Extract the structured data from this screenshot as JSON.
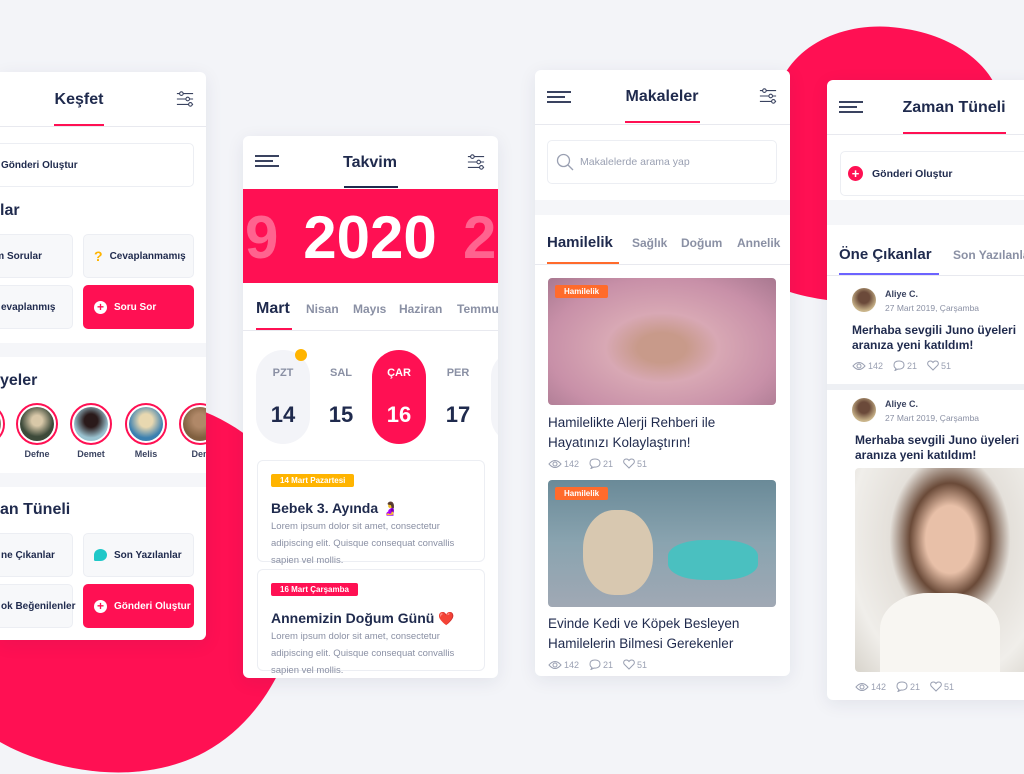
{
  "colors": {
    "accent": "#ff1053",
    "orange": "#ff6b2c",
    "yellow": "#ffb400",
    "teal": "#1fc8c8",
    "purple": "#6c63ff",
    "text": "#1f2a4d"
  },
  "kesfet": {
    "title": "Keşfet",
    "create_post": "Gönderi Oluştur",
    "questions_heading": "lar",
    "buttons": [
      "im Sorular",
      "Cevaplanmamış",
      "evaplanmış",
      "Soru Sor"
    ],
    "members_heading": "yeler",
    "members": [
      "Defne",
      "Demet",
      "Melis",
      "Den"
    ],
    "timeline_heading": "an Tüneli",
    "timeline_buttons": [
      "ne Çıkanlar",
      "Son Yazılanlar",
      "ok Beğenilenler",
      "Gönderi Oluştur"
    ]
  },
  "takvim": {
    "title": "Takvim",
    "year": "2020",
    "prev_year_digit": "9",
    "next_year_digit": "2",
    "months": [
      "Mart",
      "Nisan",
      "Mayıs",
      "Haziran",
      "Temmu"
    ],
    "active_month": "Mart",
    "days": [
      {
        "label": "PZT",
        "num": "14"
      },
      {
        "label": "SAL",
        "num": "15"
      },
      {
        "label": "ÇAR",
        "num": "16"
      },
      {
        "label": "PER",
        "num": "17"
      }
    ],
    "selected_day": "16",
    "events": [
      {
        "date": "14 Mart Pazartesi",
        "title": "Bebek 3. Ayında",
        "emoji": "🤰",
        "text": "Lorem ipsum dolor sit amet, consectetur adipiscing elit. Quisque consequat convallis sapien vel mollis."
      },
      {
        "date": "16 Mart Çarşamba",
        "title": "Annemizin Doğum Günü",
        "emoji": "❤️",
        "text": "Lorem ipsum dolor sit amet, consectetur adipiscing elit. Quisque consequat convallis sapien vel mollis."
      }
    ]
  },
  "makaleler": {
    "title": "Makaleler",
    "search_placeholder": "Makalelerde arama yap",
    "tabs": [
      "Hamilelik",
      "Sağlık",
      "Doğum",
      "Annelik"
    ],
    "active_tab": "Hamilelik",
    "articles": [
      {
        "tag": "Hamilelik",
        "title": "Hamilelikte Alerji Rehberi ile Hayatınızı Kolaylaştırın!",
        "views": "142",
        "comments": "21",
        "likes": "51"
      },
      {
        "tag": "Hamilelik",
        "title": "Evinde Kedi ve Köpek Besleyen Hamilelerin Bilmesi Gerekenler",
        "views": "142",
        "comments": "21",
        "likes": "51"
      }
    ]
  },
  "zaman": {
    "title": "Zaman Tüneli",
    "create_post": "Gönderi Oluştur",
    "tabs": [
      "Öne Çıkanlar",
      "Son Yazılanla"
    ],
    "active_tab": "Öne Çıkanlar",
    "posts": [
      {
        "author": "Aliye C.",
        "date": "27 Mart 2019, Çarşamba",
        "text": "Merhaba sevgili Juno üyeleri aranıza yeni katıldım!",
        "views": "142",
        "comments": "21",
        "likes": "51"
      },
      {
        "author": "Aliye C.",
        "date": "27 Mart 2019, Çarşamba",
        "text": "Merhaba sevgili Juno üyeleri aranıza yeni katıldım!",
        "views": "142",
        "comments": "21",
        "likes": "51"
      }
    ]
  }
}
